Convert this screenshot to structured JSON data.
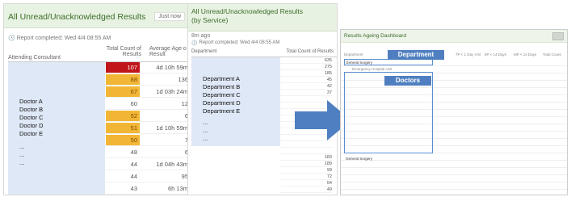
{
  "panel1": {
    "title": "All Unread/Unacknowledged Results",
    "time_badge": "Just now",
    "report_completed": "Report completed: Wed 4/4 08:55 AM",
    "col_consultant": "Attending Consultant",
    "col_total": "Total Count of Results",
    "col_avg": "Average Age o Result",
    "doctors": [
      "Doctor A",
      "Doctor B",
      "Doctor C",
      "Doctor D",
      "Doctor E",
      "...",
      "...",
      "..."
    ],
    "rows": [
      {
        "count": "107",
        "age": "4d 10h 59m",
        "color": "#c0161b"
      },
      {
        "count": "88",
        "age": "136",
        "color": "#f2b636"
      },
      {
        "count": "67",
        "age": "1d 03h 24m",
        "color": "#f2b636"
      },
      {
        "count": "60",
        "age": "12",
        "color": ""
      },
      {
        "count": "52",
        "age": "6",
        "color": "#f2b636"
      },
      {
        "count": "51",
        "age": "1d 10h 59m",
        "color": "#f2b636"
      },
      {
        "count": "50",
        "age": "7",
        "color": "#f2b636"
      },
      {
        "count": "48",
        "age": "6",
        "color": ""
      },
      {
        "count": "44",
        "age": "1d 04h 43m",
        "color": ""
      },
      {
        "count": "44",
        "age": "95",
        "color": ""
      },
      {
        "count": "43",
        "age": "6h 13m",
        "color": ""
      }
    ]
  },
  "panel2": {
    "title": "All Unread/Unacknowledged Results (by Service)",
    "age": "8m ago",
    "report_completed": "Report completed: Wed 4/4 08:55 AM",
    "col_department": "Department",
    "col_total": "Total Count of Results",
    "departments": [
      "Department A",
      "Department B",
      "Department C",
      "Department D",
      "Department E",
      "...",
      "...",
      "..."
    ],
    "counts": [
      "635",
      "275",
      "185",
      "45",
      "42",
      "37",
      "",
      "",
      "",
      "",
      "",
      "",
      "",
      "",
      "",
      "183",
      "189",
      "99",
      "72",
      "54",
      "49"
    ]
  },
  "panel3": {
    "title": "Results Ageing Dashboard",
    "label_department": "Department",
    "label_doctors": "Doctors",
    "general_surgery": "General Surgery",
    "emergency": "Emergency Hospital Unit",
    "general_surgery_2": "General Surgery",
    "columns": [
      "Department",
      "< 1 Day",
      "7P < 1 Day 4 M",
      "6P < 14 Days",
      "MP < 14 Days",
      "Total Count"
    ]
  }
}
